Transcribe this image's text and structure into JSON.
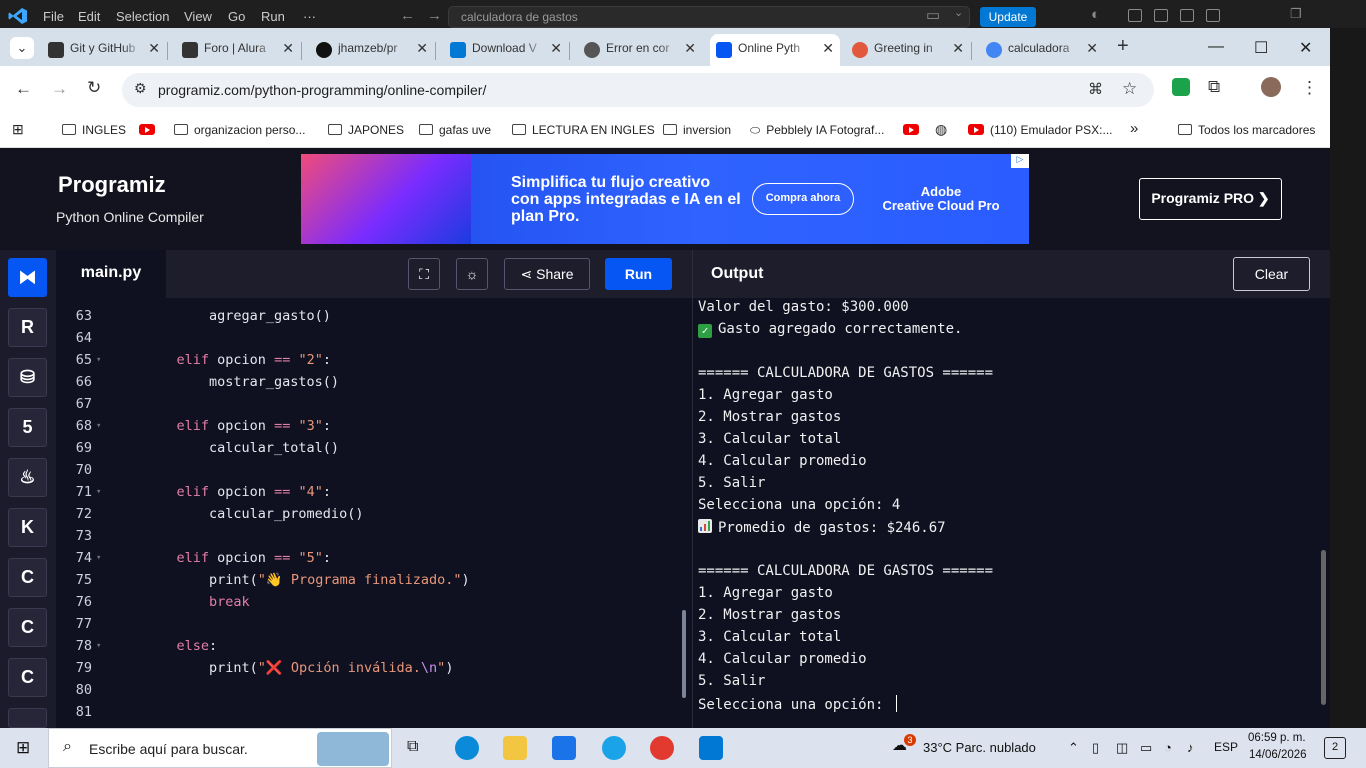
{
  "vscode": {
    "menus": [
      "File",
      "Edit",
      "Selection",
      "View",
      "Go",
      "Run",
      "···"
    ],
    "command_center": "calculadora de gastos",
    "update_label": "Update"
  },
  "chrome": {
    "tabs": [
      {
        "title": "Git y GitHub",
        "fav_color": "#333333"
      },
      {
        "title": "Foro | Alura",
        "fav_color": "#333333"
      },
      {
        "title": "jhamzeb/pr",
        "fav_color": "#111111"
      },
      {
        "title": "Download V",
        "fav_color": "#0078d4"
      },
      {
        "title": "Error en cor",
        "fav_color": "#555555"
      },
      {
        "title": "Online Pyth",
        "fav_color": "#0556f3"
      },
      {
        "title": "Greeting in",
        "fav_color": "#e2583e"
      },
      {
        "title": "calculadora",
        "fav_color": "#4285f4"
      }
    ],
    "new_tab": "+",
    "url": "programiz.com/python-programming/online-compiler/",
    "bookmarks": [
      {
        "label": "INGLES",
        "kind": "folder"
      },
      {
        "label": "",
        "kind": "youtube"
      },
      {
        "label": "organizacion perso...",
        "kind": "folder"
      },
      {
        "label": "JAPONES",
        "kind": "folder"
      },
      {
        "label": "gafas uve",
        "kind": "folder"
      },
      {
        "label": "LECTURA EN INGLES",
        "kind": "folder"
      },
      {
        "label": "inversion",
        "kind": "folder"
      },
      {
        "label": "Pebblely IA Fotograf...",
        "kind": "link"
      },
      {
        "label": "",
        "kind": "youtube"
      },
      {
        "label": "",
        "kind": "globe"
      },
      {
        "label": "(110) Emulador PSX:...",
        "kind": "youtube"
      }
    ],
    "all_bookmarks": "Todos los marcadores",
    "more": "»"
  },
  "programiz": {
    "brand": "Programiz",
    "subtitle": "Python Online Compiler",
    "ad": {
      "headline": "Simplifica tu flujo creativo con apps integradas e IA en el plan Pro.",
      "button": "Compra ahora",
      "brand_line1": "Adobe",
      "brand_line2": "Creative Cloud Pro"
    },
    "pro_button": "Programiz PRO ❯",
    "file_tab": "main.py",
    "share_label": "Share",
    "run_label": "Run",
    "output_title": "Output",
    "clear_label": "Clear"
  },
  "code_lines": [
    {
      "n": "63",
      "fold": false,
      "parts": [
        {
          "t": "        agregar_gasto()",
          "c": ""
        }
      ]
    },
    {
      "n": "64",
      "fold": false,
      "parts": [
        {
          "t": "",
          "c": ""
        }
      ]
    },
    {
      "n": "65",
      "fold": true,
      "parts": [
        {
          "t": "    elif",
          "c": "kw"
        },
        {
          "t": " opcion ",
          "c": ""
        },
        {
          "t": "==",
          "c": "kw"
        },
        {
          "t": " ",
          "c": ""
        },
        {
          "t": "\"2\"",
          "c": "st"
        },
        {
          "t": ":",
          "c": ""
        }
      ]
    },
    {
      "n": "66",
      "fold": false,
      "parts": [
        {
          "t": "        mostrar_gastos()",
          "c": ""
        }
      ]
    },
    {
      "n": "67",
      "fold": false,
      "parts": [
        {
          "t": "",
          "c": ""
        }
      ]
    },
    {
      "n": "68",
      "fold": true,
      "parts": [
        {
          "t": "    elif",
          "c": "kw"
        },
        {
          "t": " opcion ",
          "c": ""
        },
        {
          "t": "==",
          "c": "kw"
        },
        {
          "t": " ",
          "c": ""
        },
        {
          "t": "\"3\"",
          "c": "st"
        },
        {
          "t": ":",
          "c": ""
        }
      ]
    },
    {
      "n": "69",
      "fold": false,
      "parts": [
        {
          "t": "        calcular_total()",
          "c": ""
        }
      ]
    },
    {
      "n": "70",
      "fold": false,
      "parts": [
        {
          "t": "",
          "c": ""
        }
      ]
    },
    {
      "n": "71",
      "fold": true,
      "parts": [
        {
          "t": "    elif",
          "c": "kw"
        },
        {
          "t": " opcion ",
          "c": ""
        },
        {
          "t": "==",
          "c": "kw"
        },
        {
          "t": " ",
          "c": ""
        },
        {
          "t": "\"4\"",
          "c": "st"
        },
        {
          "t": ":",
          "c": ""
        }
      ]
    },
    {
      "n": "72",
      "fold": false,
      "parts": [
        {
          "t": "        calcular_promedio()",
          "c": ""
        }
      ]
    },
    {
      "n": "73",
      "fold": false,
      "parts": [
        {
          "t": "",
          "c": ""
        }
      ]
    },
    {
      "n": "74",
      "fold": true,
      "parts": [
        {
          "t": "    elif",
          "c": "kw"
        },
        {
          "t": " opcion ",
          "c": ""
        },
        {
          "t": "==",
          "c": "kw"
        },
        {
          "t": " ",
          "c": ""
        },
        {
          "t": "\"5\"",
          "c": "st"
        },
        {
          "t": ":",
          "c": ""
        }
      ]
    },
    {
      "n": "75",
      "fold": false,
      "parts": [
        {
          "t": "        print(",
          "c": ""
        },
        {
          "t": "\"👋 Programa finalizado.\"",
          "c": "st"
        },
        {
          "t": ")",
          "c": ""
        }
      ]
    },
    {
      "n": "76",
      "fold": false,
      "parts": [
        {
          "t": "        break",
          "c": "kw"
        }
      ]
    },
    {
      "n": "77",
      "fold": false,
      "parts": [
        {
          "t": "",
          "c": ""
        }
      ]
    },
    {
      "n": "78",
      "fold": true,
      "parts": [
        {
          "t": "    else",
          "c": "kw"
        },
        {
          "t": ":",
          "c": ""
        }
      ]
    },
    {
      "n": "79",
      "fold": false,
      "parts": [
        {
          "t": "        print(",
          "c": ""
        },
        {
          "t": "\"❌ Opción inválida.",
          "c": "st"
        },
        {
          "t": "\\n",
          "c": "esc"
        },
        {
          "t": "\"",
          "c": "st"
        },
        {
          "t": ")",
          "c": ""
        }
      ]
    },
    {
      "n": "80",
      "fold": false,
      "parts": [
        {
          "t": "",
          "c": ""
        }
      ]
    },
    {
      "n": "81",
      "fold": false,
      "parts": [
        {
          "t": "",
          "c": ""
        }
      ]
    }
  ],
  "output_lines": [
    {
      "text": "Valor del gasto: $300.000",
      "icon": ""
    },
    {
      "text": "Gasto agregado correctamente.",
      "icon": "check"
    },
    {
      "text": "",
      "icon": ""
    },
    {
      "text": "====== CALCULADORA DE GASTOS ======",
      "icon": ""
    },
    {
      "text": "1. Agregar gasto",
      "icon": ""
    },
    {
      "text": "2. Mostrar gastos",
      "icon": ""
    },
    {
      "text": "3. Calcular total",
      "icon": ""
    },
    {
      "text": "4. Calcular promedio",
      "icon": ""
    },
    {
      "text": "5. Salir",
      "icon": ""
    },
    {
      "text": "Selecciona una opción: 4",
      "icon": ""
    },
    {
      "text": "Promedio de gastos: $246.67",
      "icon": "chart"
    },
    {
      "text": "",
      "icon": ""
    },
    {
      "text": "====== CALCULADORA DE GASTOS ======",
      "icon": ""
    },
    {
      "text": "1. Agregar gasto",
      "icon": ""
    },
    {
      "text": "2. Mostrar gastos",
      "icon": ""
    },
    {
      "text": "3. Calcular total",
      "icon": ""
    },
    {
      "text": "4. Calcular promedio",
      "icon": ""
    },
    {
      "text": "5. Salir",
      "icon": ""
    },
    {
      "text": "Selecciona una opción: ",
      "icon": "",
      "cursor": true
    }
  ],
  "taskbar": {
    "search_placeholder": "Escribe aquí para buscar.",
    "weather": "33°C  Parc. nublado",
    "weather_badge": "3",
    "lang": "ESP",
    "time": "06:59 p. m.",
    "date": "14/06/2026",
    "notif_count": "2"
  }
}
